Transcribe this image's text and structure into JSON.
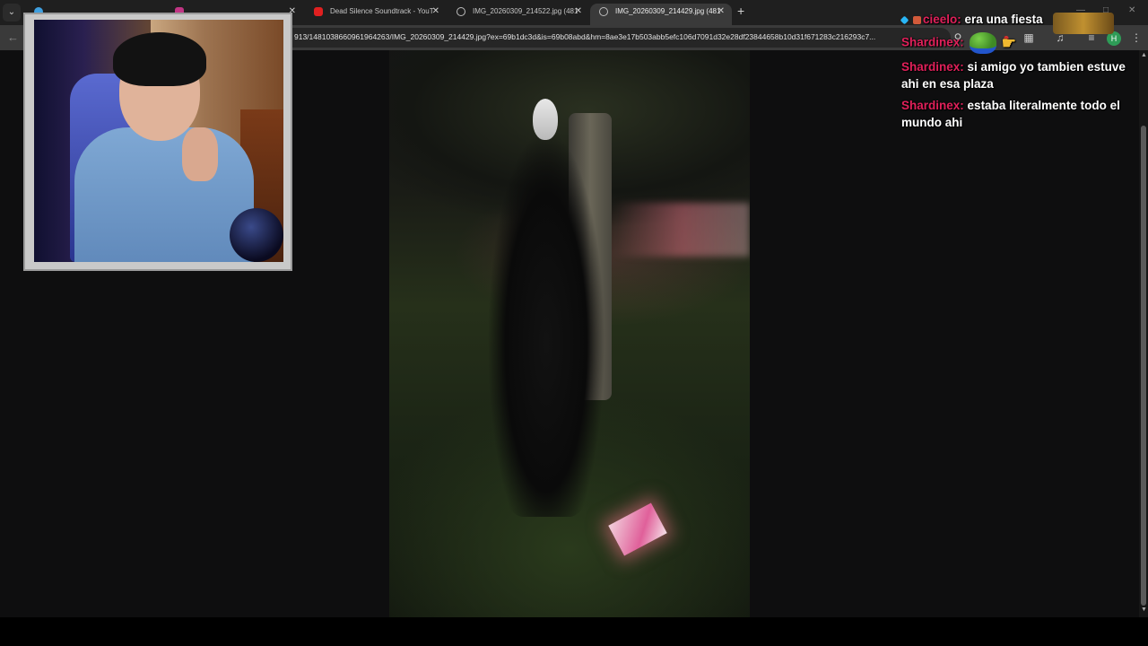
{
  "browser": {
    "tabs": [
      {
        "label": "",
        "favicon": "blue",
        "active": false
      },
      {
        "label": "",
        "favicon": "ig",
        "active": false
      },
      {
        "label": "Dead Silence Soundtrack - YouT",
        "favicon": "yt",
        "active": false
      },
      {
        "label": "IMG_20260309_214522.jpg (481",
        "favicon": "globe",
        "active": false
      },
      {
        "label": "IMG_20260309_214429.jpg (481",
        "favicon": "globe",
        "active": true
      }
    ],
    "new_tab_label": "+",
    "url": "913/1481038660961964263/IMG_20260309_214429.jpg?ex=69b1dc3d&is=69b08abd&hm=8ae3e17b503abb5efc106d7091d32e28df23844658b10d31f671283c216293c7...",
    "avatar_letter": "H"
  },
  "chat": {
    "messages": [
      {
        "user": "cieelo:",
        "text": "era una fiesta",
        "badges": [
          "pin",
          "sub"
        ]
      },
      {
        "user": "Shardinex:",
        "text": "",
        "emotes": [
          "pepe-icon",
          "pointing-hand-icon"
        ]
      },
      {
        "user": "Shardinex:",
        "text": "si amigo yo tambien estuve ahi en esa plaza"
      },
      {
        "user": "Shardinex:",
        "text": "estaba literalmente todo el mundo ahi"
      }
    ]
  },
  "colors": {
    "chat_username": "#e0205a",
    "tab_active_bg": "#3a3a3a",
    "toolbar_bg": "#3a3a3a",
    "page_bg": "#0e0e0f"
  },
  "icons": {
    "tab_menu": "chevron-down-icon",
    "back": "back-arrow-icon",
    "zoom": "zoom-icon",
    "bookmark": "star-icon",
    "extension_record": "record-icon",
    "extensions": "puzzle-icon",
    "media": "media-icon",
    "menu": "kebab-menu-icon"
  }
}
